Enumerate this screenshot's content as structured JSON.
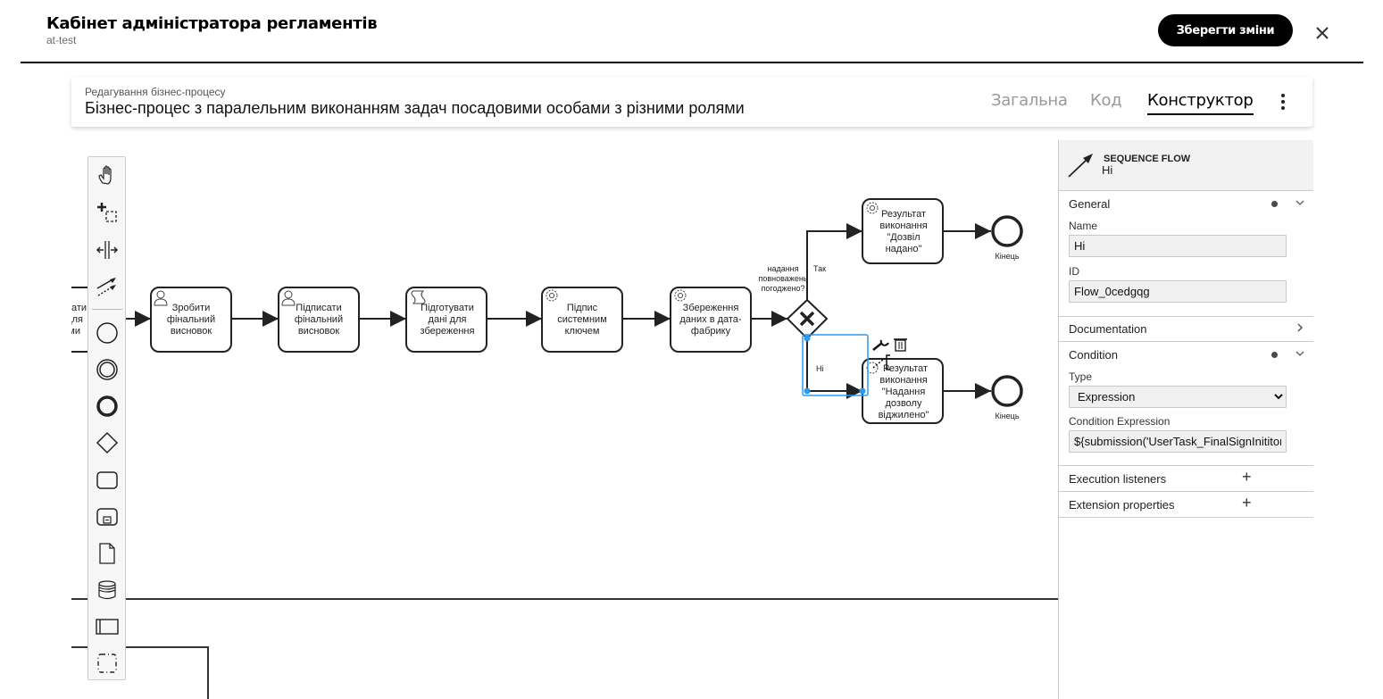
{
  "header": {
    "app_title": "Кабінет адміністратора регламентів",
    "app_subtitle": "at-test",
    "save_label": "Зберегти зміни",
    "close_icon": "close-icon"
  },
  "process_card": {
    "kicker": "Редагування бізнес-процесу",
    "title": "Бізнес-процес з паралельним виконанням задач посадовими особами з різними ролями",
    "tabs": [
      {
        "label": "Загальна",
        "active": false
      },
      {
        "label": "Код",
        "active": false
      },
      {
        "label": "Конструктор",
        "active": true
      }
    ],
    "menu_icon": "more-vertical-icon"
  },
  "palette": {
    "tools": [
      {
        "name": "hand-tool",
        "icon": "hand-icon"
      },
      {
        "name": "lasso-tool",
        "icon": "lasso-icon"
      },
      {
        "name": "space-tool",
        "icon": "space-icon"
      },
      {
        "name": "connect-tool",
        "icon": "connect-icon"
      },
      {
        "name": "start-event",
        "icon": "start-event-icon"
      },
      {
        "name": "intermediate-event",
        "icon": "intermediate-event-icon"
      },
      {
        "name": "end-event",
        "icon": "end-event-icon"
      },
      {
        "name": "gateway",
        "icon": "gateway-icon"
      },
      {
        "name": "task",
        "icon": "task-icon"
      },
      {
        "name": "subprocess",
        "icon": "subprocess-icon"
      },
      {
        "name": "data-object",
        "icon": "data-object-icon"
      },
      {
        "name": "data-store",
        "icon": "data-store-icon"
      },
      {
        "name": "pool",
        "icon": "pool-icon"
      },
      {
        "name": "group",
        "icon": "group-icon"
      }
    ]
  },
  "diagram": {
    "partial_task_lines": [
      "вати",
      "для",
      "ми"
    ],
    "tasks": [
      {
        "id": "t1",
        "type": "user",
        "lines": [
          "Зробити",
          "фінальний",
          "висновок"
        ]
      },
      {
        "id": "t2",
        "type": "user",
        "lines": [
          "Підписати",
          "фінальний",
          "висновок"
        ]
      },
      {
        "id": "t3",
        "type": "script",
        "lines": [
          "Підготувати",
          "дані для",
          "збереження"
        ]
      },
      {
        "id": "t4",
        "type": "service",
        "lines": [
          "Підпис",
          "системним",
          "ключем"
        ]
      },
      {
        "id": "t5",
        "type": "service",
        "lines": [
          "Збереження",
          "даних в дата-",
          "фабрику"
        ]
      },
      {
        "id": "t6",
        "type": "service",
        "lines": [
          "Результат",
          "виконання",
          "\"Дозвіл",
          "надано\""
        ]
      },
      {
        "id": "t7",
        "type": "service",
        "lines": [
          "Результат",
          "виконання",
          "\"Надання",
          "дозволу",
          "віджилено\""
        ]
      }
    ],
    "gateway": {
      "label_lines": [
        "надання",
        "повноважень",
        "погоджено?"
      ]
    },
    "flows": {
      "yes_label": "Так",
      "no_label": "Ні"
    },
    "end_events": [
      {
        "label": "Кінець"
      },
      {
        "label": "Кінець"
      }
    ],
    "selected_flow": "no-flow"
  },
  "properties": {
    "element_type": "SEQUENCE FLOW",
    "element_name": "Hi",
    "groups": {
      "general": {
        "label": "General",
        "name_label": "Name",
        "name_value": "Hi",
        "id_label": "ID",
        "id_value": "Flow_0cedgqg"
      },
      "documentation": {
        "label": "Documentation"
      },
      "condition": {
        "label": "Condition",
        "type_label": "Type",
        "type_value": "Expression",
        "expr_label": "Condition Expression",
        "expr_value": "${submission('UserTask_FinalSignInititor"
      },
      "execution_listeners": {
        "label": "Execution listeners"
      },
      "extension_properties": {
        "label": "Extension properties"
      }
    }
  }
}
